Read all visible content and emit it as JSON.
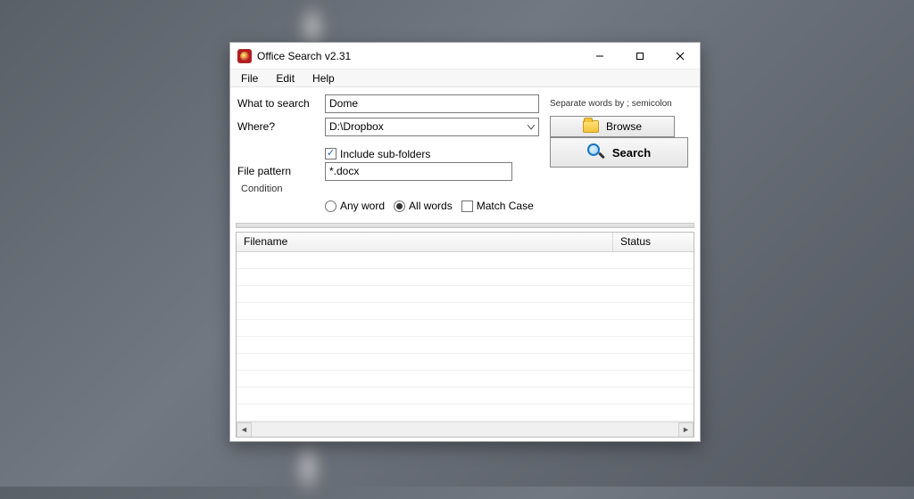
{
  "title": "Office Search v2.31",
  "menu": {
    "file": "File",
    "edit": "Edit",
    "help": "Help"
  },
  "labels": {
    "what": "What to search",
    "where": "Where?",
    "pattern": "File pattern",
    "condition_legend": "Condition"
  },
  "inputs": {
    "what_value": "Dome",
    "where_value": "D:\\Dropbox",
    "pattern_value": "*.docx"
  },
  "hint": "Separate words by ; semicolon",
  "buttons": {
    "browse": "Browse",
    "search": "Search"
  },
  "options": {
    "include_sub": "Include sub-folders",
    "include_sub_checked": true,
    "any_word": "Any word",
    "all_words": "All words",
    "match_case": "Match Case",
    "selected_radio": "all_words",
    "match_case_checked": false
  },
  "results": {
    "col_filename": "Filename",
    "col_status": "Status"
  }
}
